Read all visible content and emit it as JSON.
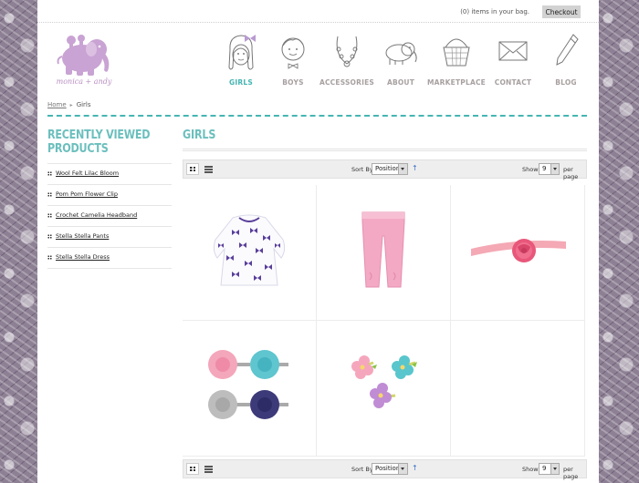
{
  "header": {
    "bag_text": "(0) items in your bag.",
    "checkout_label": "Checkout",
    "logo_text": "monica + andy"
  },
  "nav": [
    {
      "label": "GIRLS",
      "icon": "girl-face-icon",
      "active": true
    },
    {
      "label": "BOYS",
      "icon": "boy-face-icon",
      "active": false
    },
    {
      "label": "ACCESSORIES",
      "icon": "necklace-icon",
      "active": false
    },
    {
      "label": "ABOUT",
      "icon": "elephant-icon",
      "active": false
    },
    {
      "label": "MARKETPLACE",
      "icon": "basket-icon",
      "active": false
    },
    {
      "label": "CONTACT",
      "icon": "envelope-icon",
      "active": false
    },
    {
      "label": "BLOG",
      "icon": "pencil-icon",
      "active": false
    }
  ],
  "breadcrumb": {
    "home": "Home",
    "current": "Girls"
  },
  "sidebar": {
    "title_line1": "RECENTLY VIEWED",
    "title_line2": "PRODUCTS",
    "items": [
      "Wool Felt Lilac Bloom",
      "Pom Pom Flower Clip",
      "Crochet Camelia Headband",
      "Stella Stella Pants",
      "Stella Stella Dress"
    ]
  },
  "main": {
    "title": "GIRLS",
    "toolbar": {
      "sort_label": "Sort By",
      "sort_value": "Position",
      "sort_direction_icon": "up-arrow-icon",
      "show_label": "Show",
      "show_value": "9",
      "per_page_label": "per page"
    },
    "products": [
      {
        "image": "butterfly-print-dress"
      },
      {
        "image": "pink-ruched-pants"
      },
      {
        "image": "crochet-flower-headband"
      },
      {
        "image": "felt-flower-clips-set"
      },
      {
        "image": "pom-pom-flower-clips"
      }
    ]
  },
  "colors": {
    "accent": "#45b5b3",
    "heading": "#6bbfbd",
    "logo": "#c9a3d3",
    "side_pattern": "#8d8094"
  }
}
